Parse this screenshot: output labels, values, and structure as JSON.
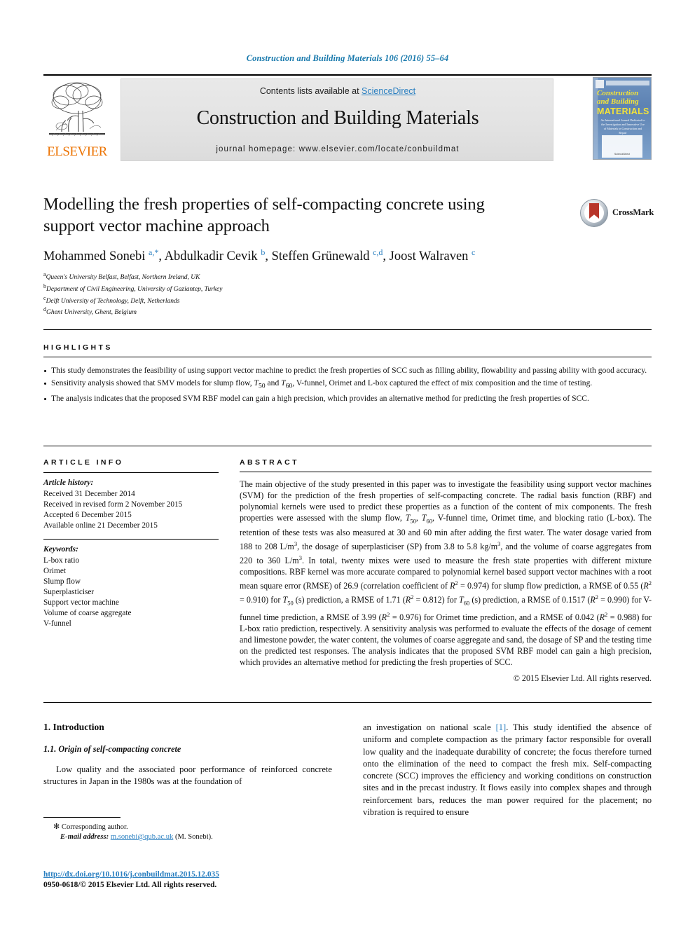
{
  "running_head": "Construction and Building Materials 106 (2016) 55–64",
  "masthead": {
    "contents_prefix": "Contents lists available at ",
    "sciencedirect": "ScienceDirect",
    "journal_title": "Construction and Building Materials",
    "homepage": "journal homepage: www.elsevier.com/locate/conbuildmat",
    "publisher_wordmark": "ELSEVIER",
    "cover": {
      "line1": "Construction",
      "line2": "and Building",
      "line3": "MATERIALS",
      "blurb": "An International Journal Dedicated to the Investigation and Innovative Use of Materials in Construction and Repair",
      "foot": "ScienceDirect"
    }
  },
  "article": {
    "title": "Modelling the fresh properties of self-compacting concrete using support vector machine approach",
    "crossmark_label": "CrossMark",
    "authors_html": "Mohammed Sonebi <sup class=\"aff-marker\">a,*</sup>, Abdulkadir Cevik <sup class=\"aff-marker\">b</sup>, Steffen Grünewald <sup class=\"aff-marker\">c,d</sup>, Joost Walraven <sup class=\"aff-marker\">c</sup>",
    "affiliations": [
      {
        "mark": "a",
        "text": "Queen's University Belfast, Belfast, Northern Ireland, UK"
      },
      {
        "mark": "b",
        "text": "Department of Civil Engineering, University of Gaziantep, Turkey"
      },
      {
        "mark": "c",
        "text": "Delft University of Technology, Delft, Netherlands"
      },
      {
        "mark": "d",
        "text": "Ghent University, Ghent, Belgium"
      }
    ]
  },
  "highlights": {
    "heading": "HIGHLIGHTS",
    "items_html": [
      "This study demonstrates the feasibility of using support vector machine to predict the fresh properties of SCC such as filling ability, flowability and passing ability with good accuracy.",
      "Sensitivity analysis showed that SMV models for slump flow, <i>T</i><sub>50</sub> and <i>T</i><sub>60</sub>, V-funnel, Orimet and L-box captured the effect of mix composition and the time of testing.",
      "The analysis indicates that the proposed SVM RBF model can gain a high precision, which provides an alternative method for predicting the fresh properties of SCC."
    ]
  },
  "article_info": {
    "heading": "ARTICLE INFO",
    "history_label": "Article history:",
    "history": [
      "Received 31 December 2014",
      "Received in revised form 2 November 2015",
      "Accepted 6 December 2015",
      "Available online 21 December 2015"
    ],
    "keywords_label": "Keywords:",
    "keywords": [
      "L-box ratio",
      "Orimet",
      "Slump flow",
      "Superplasticiser",
      "Support vector machine",
      "Volume of coarse aggregate",
      "V-funnel"
    ]
  },
  "abstract": {
    "heading": "ABSTRACT",
    "body_html": "The main objective of the study presented in this paper was to investigate the feasibility using support vector machines (SVM) for the prediction of the fresh properties of self-compacting concrete. The radial basis function (RBF) and polynomial kernels were used to predict these properties as a function of the content of mix components. The fresh properties were assessed with the slump flow, <i>T</i><sub>50</sub>, <i>T</i><sub>60</sub>, V-funnel time, Orimet time, and blocking ratio (L-box). The retention of these tests was also measured at 30 and 60 min after adding the first water. The water dosage varied from 188 to 208 L/m<sup>3</sup>, the dosage of superplasticiser (SP) from 3.8 to 5.8 kg/m<sup>3</sup>, and the volume of coarse aggregates from 220 to 360 L/m<sup>3</sup>. In total, twenty mixes were used to measure the fresh state properties with different mixture compositions. RBF kernel was more accurate compared to polynomial kernel based support vector machines with a root mean square error (RMSE) of 26.9 (correlation coefficient of <i>R</i><sup>2</sup> = 0.974) for slump flow prediction, a RMSE of 0.55 (<i>R</i><sup>2</sup> = 0.910) for <i>T</i><sub>50</sub> (s) prediction, a RMSE of 1.71 (<i>R</i><sup>2</sup> = 0.812) for <i>T</i><sub>60</sub> (s) prediction, a RMSE of 0.1517 (<i>R</i><sup>2</sup> = 0.990) for V-funnel time prediction, a RMSE of 3.99 (<i>R</i><sup>2</sup> = 0.976) for Orimet time prediction, and a RMSE of 0.042 (<i>R</i><sup>2</sup> = 0.988) for L-box ratio prediction, respectively. A sensitivity analysis was performed to evaluate the effects of the dosage of cement and limestone powder, the water content, the volumes of coarse aggregate and sand, the dosage of SP and the testing time on the predicted test responses. The analysis indicates that the proposed SVM RBF model can gain a high precision, which provides an alternative method for predicting the fresh properties of SCC.",
    "copyright": "© 2015 Elsevier Ltd. All rights reserved."
  },
  "body": {
    "section_number_title": "1. Introduction",
    "subsection_title": "1.1. Origin of self-compacting concrete",
    "left_paragraph": "Low quality and the associated poor performance of reinforced concrete structures in Japan in the 1980s was at the foundation of",
    "right_paragraph_html": "an investigation on national scale <span class=\"cite-link\">[1]</span>. This study identified the absence of uniform and complete compaction as the primary factor responsible for overall low quality and the inadequate durability of concrete; the focus therefore turned onto the elimination of the need to compact the fresh mix. Self-compacting concrete (SCC) improves the efficiency and working conditions on construction sites and in the precast industry. It flows easily into complex shapes and through reinforcement bars, reduces the man power required for the placement; no vibration is required to ensure"
  },
  "footnote": {
    "corresponding_author": "Corresponding author.",
    "email_label": "E-mail address:",
    "email": "m.sonebi@qub.ac.uk",
    "email_suffix": "(M. Sonebi)."
  },
  "imprint": {
    "doi": "http://dx.doi.org/10.1016/j.conbuildmat.2015.12.035",
    "issn_line": "0950-0618/© 2015 Elsevier Ltd. All rights reserved."
  },
  "colors": {
    "link_blue": "#2a7fc0",
    "running_head_blue": "#1a7aad",
    "elsevier_orange": "#ec7404",
    "crossmark_red": "#b8352a",
    "cover_blue": "#5d82b3",
    "cover_yellow": "#f2e23a"
  }
}
